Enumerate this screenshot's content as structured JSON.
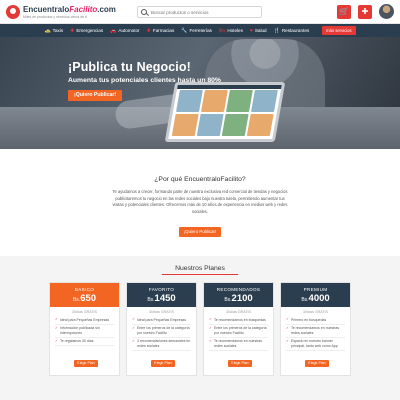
{
  "header": {
    "logo_main": "Encuentralo",
    "logo_accent": "Facilito",
    "logo_suffix": ".com",
    "logo_tagline": "Miles de productos y servicios cerca de ti",
    "search_placeholder": "Buscar productos o servicios",
    "icons": [
      "cart-icon",
      "medkit-icon"
    ]
  },
  "nav": {
    "items": [
      {
        "icon": "taxi-icon",
        "glyph": "🚕",
        "label": "Taxis"
      },
      {
        "icon": "emergency-icon",
        "glyph": "✚",
        "label": "Emergencias"
      },
      {
        "icon": "car-icon",
        "glyph": "🚗",
        "label": "Automotor"
      },
      {
        "icon": "pharmacy-icon",
        "glyph": "✚",
        "label": "Farmacias"
      },
      {
        "icon": "hardware-icon",
        "glyph": "🔧",
        "label": "Ferreterías"
      },
      {
        "icon": "hotel-icon",
        "glyph": "🛏",
        "label": "Hoteles"
      },
      {
        "icon": "health-icon",
        "glyph": "♥",
        "label": "Salud"
      },
      {
        "icon": "restaurant-icon",
        "glyph": "🍴",
        "label": "Restaurantes"
      }
    ],
    "cta": "más servicios"
  },
  "hero": {
    "title": "¡Publica tu Negocio!",
    "subtitle": "Aumenta tus potenciales clientes hasta un 80%",
    "button": "¡Quiero Publicar!"
  },
  "about": {
    "title": "¿Por qué EncuentraloFacilito?",
    "text": "Te ayudamos a crecer, formando parte de nuestra exclusiva red comercial de tiendas y negocios publicitaremos tu negocio en las redes sociales bajo nuestra tutela, permitiendo aumentar tus visitas y potenciales clientes. Ofrecemos más de 10 años de experiencia en medios web y redes sociales.",
    "button": "¡Quiero Publicar!"
  },
  "plans": {
    "title": "Nuestros Planes",
    "items": [
      {
        "name": "BASICO",
        "currency": "Bs.",
        "price": "650",
        "days": "30días GRATIS",
        "features": [
          "Ideal para Pequeñas Empresas",
          "Información publicada sin interrupciones",
          "Te regalamos 30 días"
        ],
        "button": "Elegir Plan"
      },
      {
        "name": "FAVORITO",
        "currency": "Bs.",
        "price": "1450",
        "days": "30días GRATIS",
        "features": [
          "Ideal para Pequeñas Empresas",
          "Entre los primeros de la categoría por nuestro Facilito",
          "3 recomendaciones semanales en redes sociales"
        ],
        "button": "Elegir Plan"
      },
      {
        "name": "RECOMENDADOS",
        "currency": "Bs.",
        "price": "2100",
        "days": "30días GRATIS",
        "features": [
          "Te recomendamos en búsquedas",
          "Entre los primeros de la categoría por nuestro Facilito",
          "Te recomendamos en nuestras redes sociales"
        ],
        "button": "Elegir Plan"
      },
      {
        "name": "PREMIUM",
        "currency": "Bs.",
        "price": "4000",
        "days": "30días GRATIS",
        "features": [
          "Primero en búsquedas",
          "Te recomendamos en nuestras redes sociales",
          "Espacio en nuestro banner principal, tanto web como App"
        ],
        "button": "Elegir Plan"
      }
    ]
  },
  "colors": {
    "brand_red": "#e53935",
    "cta_orange": "#f26522",
    "navy": "#2b3e50"
  }
}
